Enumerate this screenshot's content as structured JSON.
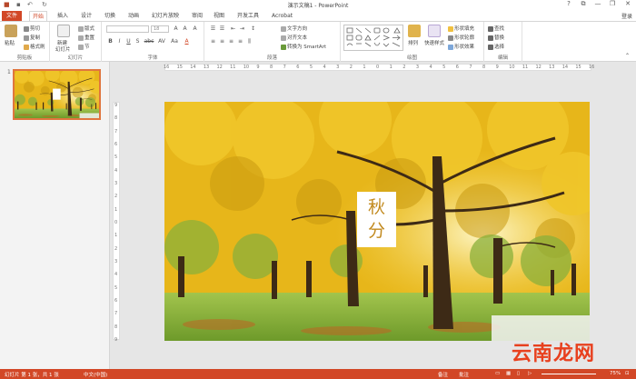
{
  "app": {
    "title": "演示文稿1 - PowerPoint"
  },
  "window": {
    "help": "?",
    "minimize": "—",
    "restore": "❐",
    "close": "✕",
    "ribbon_display": "⧉"
  },
  "quick_access": {
    "save": "▪",
    "undo": "↶",
    "redo": "↻"
  },
  "tabs": [
    "文件",
    "开始",
    "插入",
    "设计",
    "切换",
    "动画",
    "幻灯片放映",
    "审阅",
    "视图",
    "开发工具",
    "Acrobat"
  ],
  "login": "登录",
  "ribbon": {
    "clipboard": {
      "label": "剪贴板",
      "paste": "粘贴",
      "cut": "剪切",
      "copy": "复制",
      "format_painter": "格式刷"
    },
    "slides": {
      "label": "幻灯片",
      "new_slide": "新建",
      "new_slide2": "幻灯片",
      "layout": "版式",
      "reset": "重置",
      "section": "节"
    },
    "font": {
      "label": "字体",
      "font_name": "",
      "font_size": "18",
      "bold": "B",
      "italic": "I",
      "underline": "U",
      "shadow": "S",
      "strike": "abc",
      "spacing": "AV",
      "case": "Aa",
      "color": "A",
      "grow": "A",
      "shrink": "A",
      "clear": "A"
    },
    "paragraph": {
      "label": "段落",
      "text_direction": "文字方向",
      "align_text": "对齐文本",
      "smartart": "转换为 SmartArt"
    },
    "drawing": {
      "label": "绘图",
      "arrange": "排列",
      "quick_styles": "快速样式",
      "shape_fill": "形状填充",
      "shape_outline": "形状轮廓",
      "shape_effects": "形状效果"
    },
    "editing": {
      "label": "编辑",
      "find": "查找",
      "replace": "替换",
      "select": "选择"
    }
  },
  "thumbnail": {
    "number": "1"
  },
  "hruler_ticks": [
    "16",
    "15",
    "14",
    "13",
    "12",
    "11",
    "10",
    "9",
    "8",
    "7",
    "6",
    "5",
    "4",
    "3",
    "2",
    "1",
    "0",
    "1",
    "2",
    "3",
    "4",
    "5",
    "6",
    "7",
    "8",
    "9",
    "10",
    "11",
    "12",
    "13",
    "14",
    "15",
    "16"
  ],
  "vruler_ticks": [
    "9",
    "8",
    "7",
    "6",
    "5",
    "4",
    "3",
    "2",
    "1",
    "0",
    "1",
    "2",
    "3",
    "4",
    "5",
    "6",
    "7",
    "8",
    "9"
  ],
  "slide": {
    "title_line1": "秋",
    "title_line2": "分"
  },
  "status": {
    "slide_info": "幻灯片 第 1 张，共 1 张",
    "language": "中文(中国)",
    "notes": "备注",
    "comments": "批注",
    "zoom": "75%"
  },
  "watermark": "云南龙网",
  "colors": {
    "accent": "#d24726",
    "title_text": "#c28a1f"
  }
}
